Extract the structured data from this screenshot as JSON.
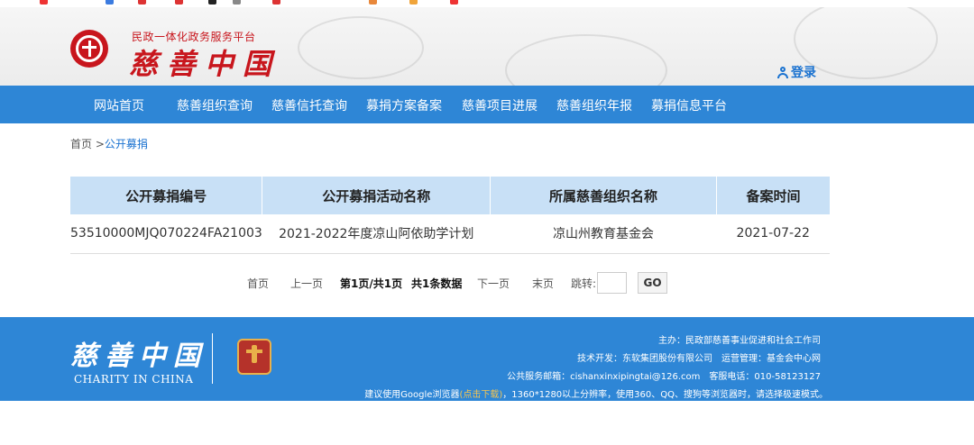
{
  "header": {
    "site_sub": "民政一体化政务服务平台",
    "site_name": "慈善中国",
    "login": "登录"
  },
  "nav": [
    "网站首页",
    "慈善组织查询",
    "慈善信托查询",
    "募捐方案备案",
    "慈善项目进展",
    "慈善组织年报",
    "募捐信息平台"
  ],
  "breadcrumb": {
    "home": "首页",
    "sep": " >",
    "current": "公开募捐"
  },
  "table": {
    "headers": [
      "公开募捐编号",
      "公开募捐活动名称",
      "所属慈善组织名称",
      "备案时间"
    ],
    "rows": [
      [
        "53510000MJQ070224FA21003",
        "2021-2022年度凉山阿依助学计划",
        "凉山州教育基金会",
        "2021-07-22"
      ]
    ]
  },
  "pager": {
    "first": "首页",
    "prev": "上一页",
    "page_info": "第1页/共1页",
    "total": "共1条数据",
    "next": "下一页",
    "last": "末页",
    "jump_label": "跳转:",
    "go": "GO"
  },
  "footer": {
    "logo": "慈善中国",
    "logo_en": "CHARITY IN CHINA",
    "sponsor": "主办：民政部慈善事业促进和社会工作司",
    "tech": "技术开发：东软集团股份有限公司　运营管理：基金会中心网",
    "email": "公共服务邮箱：cishanxinxipingtai@126.com　客服电话：010-58123127",
    "browser_pre": "建议使用Google浏览器",
    "browser_link": "(点击下载)",
    "browser_post": "，1360*1280以上分辨率，使用360、QQ、搜狗等浏览器时，请选择极速模式。"
  },
  "colors": {
    "brand_red": "#c8161d",
    "nav_blue": "#2e86d6",
    "table_header": "#c8e0f6",
    "link_blue": "#1a72d0"
  }
}
